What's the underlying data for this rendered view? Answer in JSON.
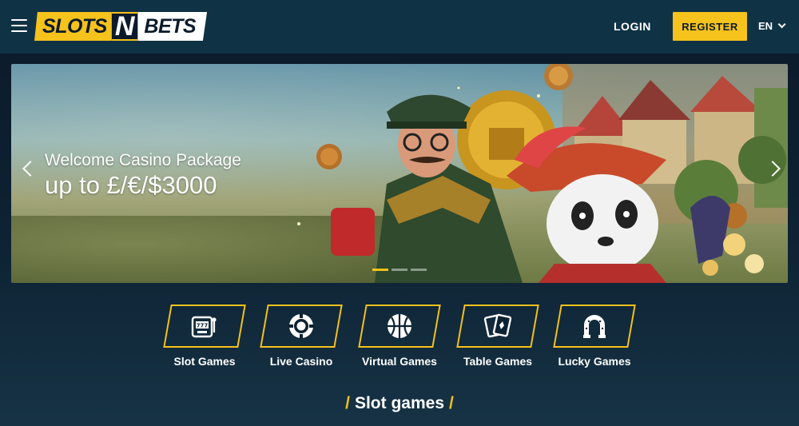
{
  "header": {
    "logo_part1": "SLOTS",
    "logo_n": "N",
    "logo_part2": "BETS",
    "login_label": "LOGIN",
    "register_label": "REGISTER",
    "language": "EN"
  },
  "banner": {
    "title": "Welcome Casino Package",
    "subtitle": "up to £/€/$3000",
    "slides": 3,
    "active_slide": 1
  },
  "categories": [
    {
      "label": "Slot Games",
      "icon": "slot-machine-icon"
    },
    {
      "label": "Live Casino",
      "icon": "casino-chip-icon"
    },
    {
      "label": "Virtual Games",
      "icon": "basketball-icon"
    },
    {
      "label": "Table Games",
      "icon": "playing-cards-icon"
    },
    {
      "label": "Lucky Games",
      "icon": "horseshoe-icon"
    }
  ],
  "section": {
    "title": "Slot games",
    "slash": "/"
  },
  "colors": {
    "accent": "#f6c21c",
    "header_bg": "#0f3245",
    "page_bg": "#0b1a2a"
  }
}
